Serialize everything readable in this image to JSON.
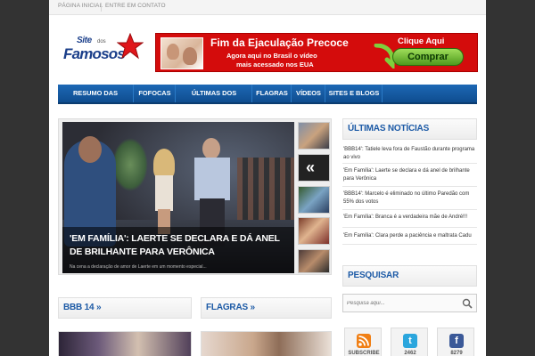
{
  "topnav": {
    "home": "PÁGINA INICIAL",
    "contact": "ENTRE EM CONTATO"
  },
  "logo": {
    "line1": "Site",
    "line2": "dos",
    "line3": "Famosos"
  },
  "ad": {
    "headline": "Fim da Ejaculação Precoce",
    "sub1": "Agora aqui no Brasil o vídeo",
    "sub2": "mais acessado nos EUA",
    "cta_top": "Clique Aqui",
    "cta_button": "Comprar"
  },
  "mainnav": [
    "RESUMO DAS NOVELAS",
    "FOFOCAS",
    "ÚLTIMAS DOS FAMOSOS",
    "FLAGRAS",
    "VÍDEOS",
    "SITES E BLOGS"
  ],
  "slider": {
    "caption": "'Em Família': Laerte se declara e dá anel de brilhante para Verônica",
    "excerpt": "Na cena a declaração de amor de Laerte em um momento especial..."
  },
  "sections": {
    "bbb": "BBB 14",
    "flagras": "FLAGRAS",
    "ultimas": "ÚLTIMAS NOTÍCIAS",
    "pesquisar": "PESQUISAR"
  },
  "news": [
    "'BBB14': Tatiele leva fora de Faustão durante programa ao vivo",
    "'Em Família': Laerte se declara e dá anel de brilhante para Verônica",
    "'BBB14': Marcelo é eliminado no último Paredão com 55% dos votos",
    "'Em Família': Branca é a verdadeira mãe de André!!!",
    "'Em Família': Clara perde a paciência e maltrata Cadu"
  ],
  "search": {
    "placeholder": "Pesquisa aqui..."
  },
  "social": {
    "rss": "SUBSCRIBE",
    "twitter": "2462",
    "facebook": "8279"
  },
  "colors": {
    "nav": "#1d68b5",
    "accent": "#1c5aa6",
    "ad_red": "#d40c0c"
  }
}
